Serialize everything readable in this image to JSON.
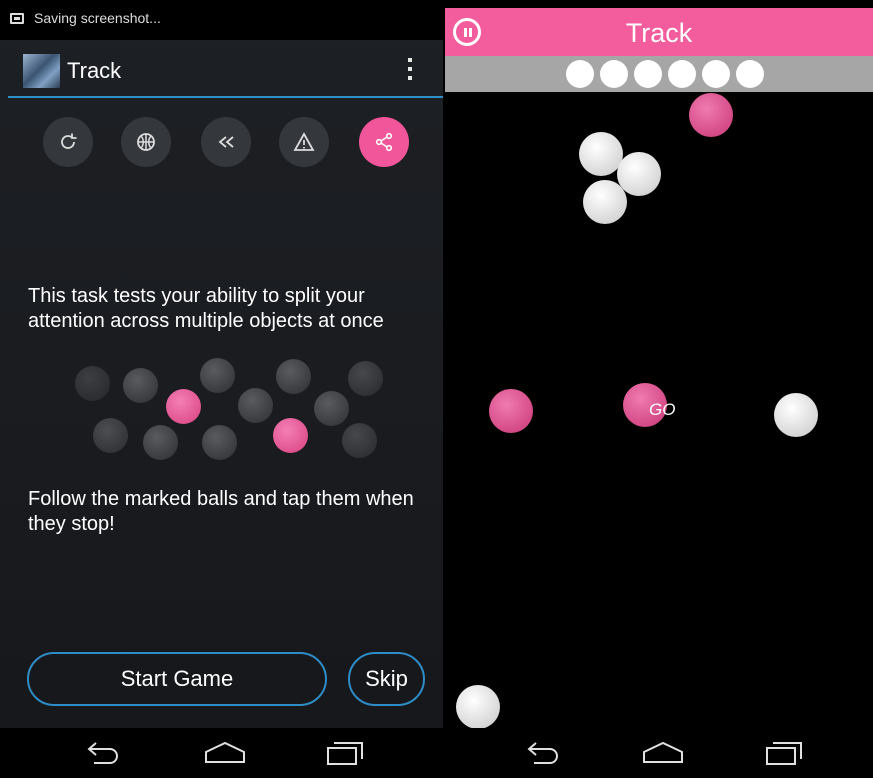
{
  "left_panel": {
    "status_text": "Saving screenshot...",
    "app_title": "Track",
    "toolbar_icons": [
      {
        "name": "refresh-icon"
      },
      {
        "name": "basketball-icon"
      },
      {
        "name": "rewind-icon"
      },
      {
        "name": "warning-icon"
      },
      {
        "name": "share-icon",
        "active": true
      }
    ],
    "description": "This task tests your ability to split your attention across multiple objects at once",
    "instruction": "Follow the marked balls and tap them when they stop!",
    "start_label": "Start Game",
    "skip_label": "Skip"
  },
  "game": {
    "title": "Track",
    "lives_remaining": 6,
    "go_label": "GO",
    "colors": {
      "accent": "#f35c9d",
      "ball_pink": "#d44a86",
      "ball_white": "#ffffff",
      "button_border": "#2e8cc6"
    }
  },
  "navbar": {
    "buttons": [
      "back-icon",
      "home-icon",
      "recents-icon"
    ]
  }
}
